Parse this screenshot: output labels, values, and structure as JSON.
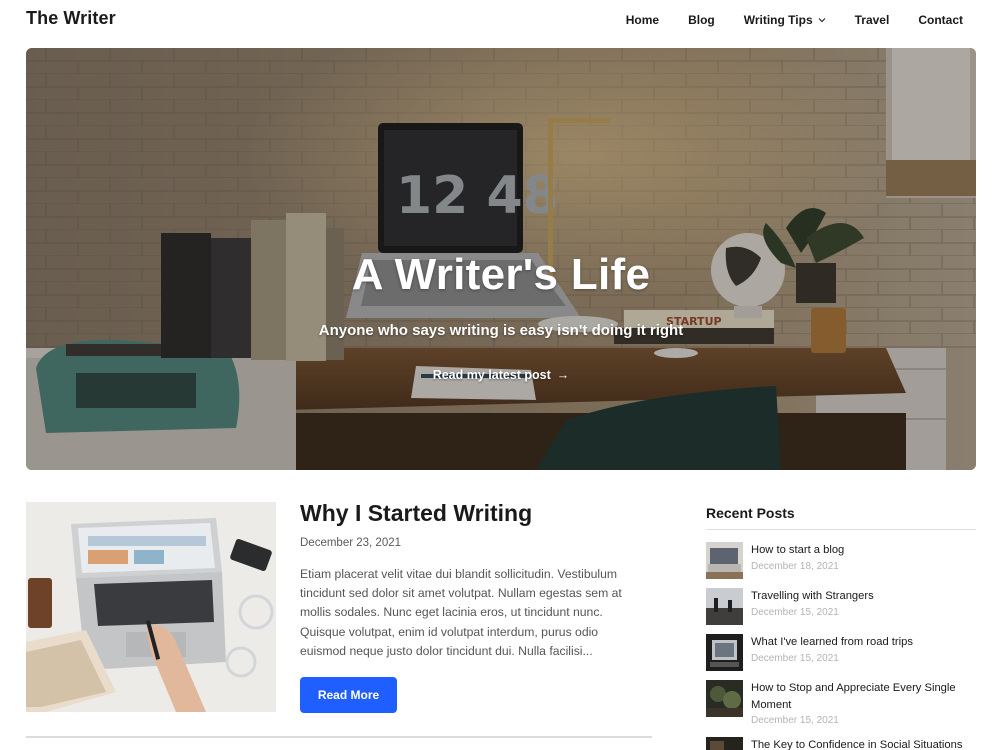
{
  "site": {
    "title": "The Writer"
  },
  "nav": {
    "items": [
      {
        "label": "Home"
      },
      {
        "label": "Blog"
      },
      {
        "label": "Writing Tips",
        "has_dropdown": true
      },
      {
        "label": "Travel"
      },
      {
        "label": "Contact"
      }
    ]
  },
  "hero": {
    "title": "A Writer's Life",
    "subtitle": "Anyone who says writing is easy isn't doing it right",
    "link_label": "Read my latest post",
    "link_icon": "arrow-right-icon",
    "clock_digits": "12 48",
    "book_label": "STARTUP"
  },
  "post": {
    "title": "Why I Started Writing",
    "date": "December 23, 2021",
    "excerpt": "Etiam placerat velit vitae dui blandit sollicitudin. Vestibulum tincidunt sed dolor sit amet volutpat. Nullam egestas sem at mollis sodales. Nunc eget lacinia eros, ut tincidunt nunc. Quisque volutpat, enim id volutpat interdum, purus odio euismod neque justo dolor tincidunt dui. Nulla facilisi...",
    "button_label": "Read More"
  },
  "sidebar": {
    "title": "Recent Posts",
    "posts": [
      {
        "title": "How to start a blog",
        "date": "December 18, 2021"
      },
      {
        "title": "Travelling with Strangers",
        "date": "December 15, 2021"
      },
      {
        "title": "What I've learned from road trips",
        "date": "December 15, 2021"
      },
      {
        "title": "How to Stop and Appreciate Every Single Moment",
        "date": "December 15, 2021"
      },
      {
        "title": "The Key to Confidence in Social Situations",
        "date": ""
      }
    ]
  },
  "colors": {
    "accent": "#1f5eff",
    "text": "#1a1a1a",
    "muted": "#5a5a5a",
    "date_light": "#b4b4b4"
  }
}
